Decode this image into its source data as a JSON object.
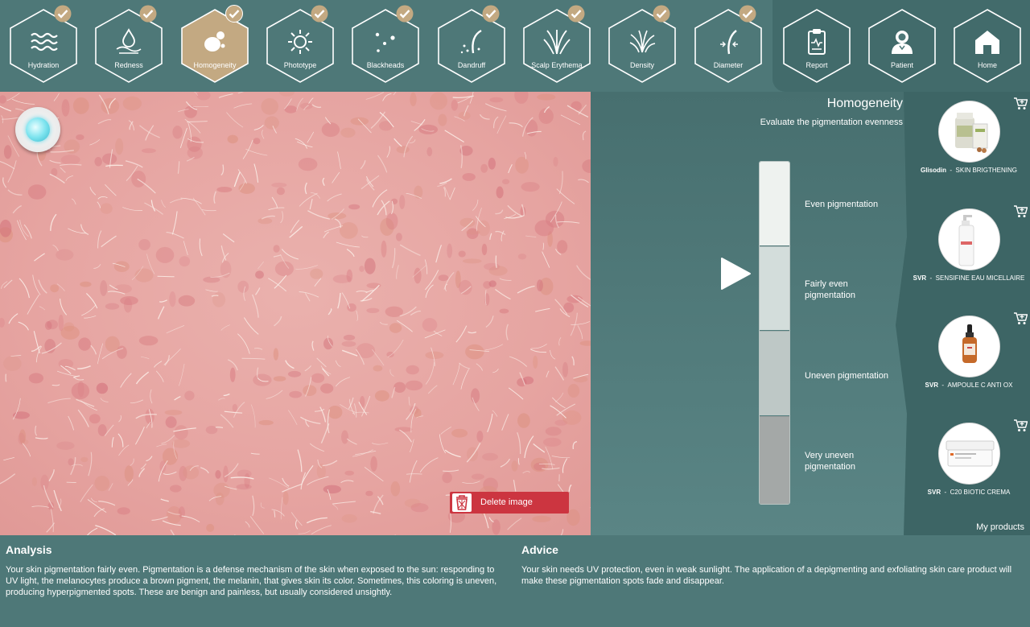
{
  "nav": {
    "items": [
      {
        "label": "Hydration",
        "icon": "waves-icon",
        "checked": true,
        "active": false
      },
      {
        "label": "Redness",
        "icon": "drop-icon",
        "checked": true,
        "active": false
      },
      {
        "label": "Homogeneity",
        "icon": "spots-icon",
        "checked": true,
        "active": true
      },
      {
        "label": "Phototype",
        "icon": "sun-icon",
        "checked": true,
        "active": false
      },
      {
        "label": "Blackheads",
        "icon": "dots-icon",
        "checked": true,
        "active": false
      },
      {
        "label": "Dandruff",
        "icon": "hair-flakes-icon",
        "checked": true,
        "active": false
      },
      {
        "label": "Scalp Erythema",
        "icon": "grass-icon",
        "checked": true,
        "active": false
      },
      {
        "label": "Density",
        "icon": "hair-tuft-icon",
        "checked": true,
        "active": false
      },
      {
        "label": "Diameter",
        "icon": "hair-diameter-icon",
        "checked": true,
        "active": false
      }
    ],
    "right": [
      {
        "label": "Report",
        "icon": "clipboard-icon"
      },
      {
        "label": "Patient",
        "icon": "person-icon"
      },
      {
        "label": "Home",
        "icon": "home-icon"
      }
    ]
  },
  "image_panel": {
    "delete_label": "Delete image"
  },
  "evaluation": {
    "title": "Homogeneity",
    "subtitle": "Evaluate the pigmentation evenness",
    "levels": [
      "Even pigmentation",
      "Fairly even pigmentation",
      "Uneven pigmentation",
      "Very uneven pigmentation"
    ],
    "selected_index": 1
  },
  "products": {
    "items": [
      {
        "brand": "Glisodin",
        "name": "SKIN BRIGTHENING"
      },
      {
        "brand": "SVR",
        "name": "SENSIFINE EAU MICELLAIRE"
      },
      {
        "brand": "SVR",
        "name": "AMPOULE C ANTI OX"
      },
      {
        "brand": "SVR",
        "name": "C20 BIOTIC CREMA"
      }
    ],
    "footer_label": "My products"
  },
  "analysis": {
    "title": "Analysis",
    "text": "Your skin pigmentation fairly even. Pigmentation is a defense mechanism of the skin when exposed to the sun: responding to UV light, the melanocytes produce a brown pigment, the melanin, that gives skin its color. Sometimes, this coloring is uneven, producing hyperpigmented spots. These are benign and painless, but usually considered unsightly."
  },
  "advice": {
    "title": "Advice",
    "text": "Your skin needs UV protection, even in weak sunlight. The application of a depigmenting and exfoliating skin care product will make these pigmentation spots fade and disappear."
  },
  "colors": {
    "background": "#4e7878",
    "active_tab": "#c3a982",
    "delete_red": "#cc3540"
  }
}
